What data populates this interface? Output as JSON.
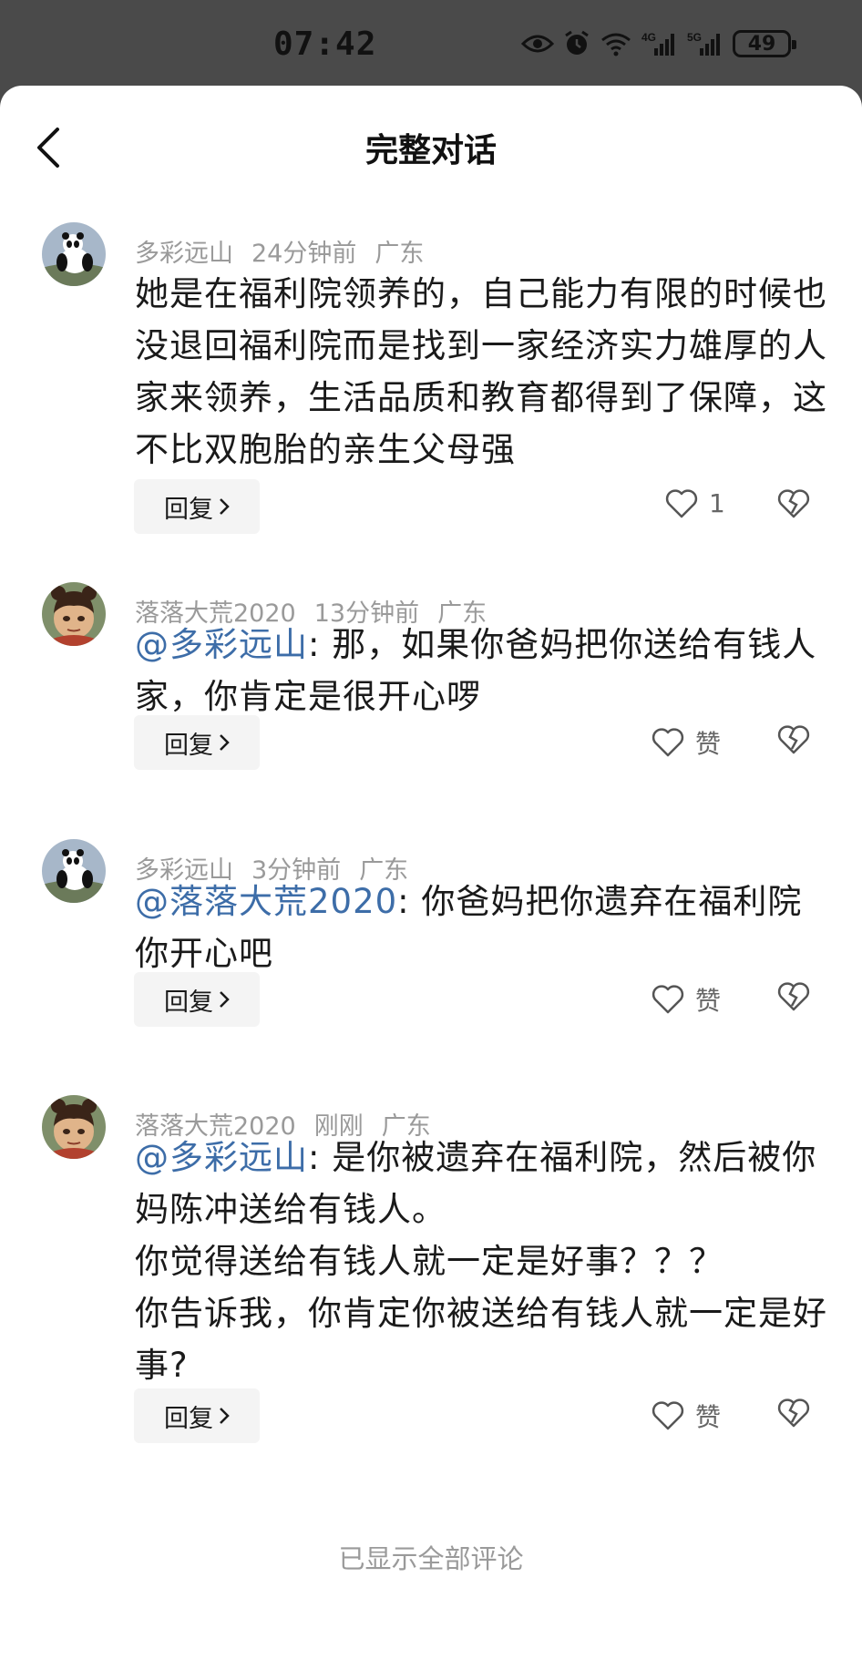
{
  "status": {
    "time": "07:42",
    "battery": "49"
  },
  "header": {
    "title": "完整对话"
  },
  "comments": [
    {
      "user": "多彩远山",
      "time": "24分钟前",
      "location": "广东",
      "mention": "",
      "text": "她是在福利院领养的，自己能力有限的时候也没退回福利院而是找到一家经济实力雄厚的人家来领养，生活品质和教育都得到了保障，这不比双胞胎的亲生父母强",
      "reply_label": "回复",
      "like_label": "1",
      "avatar": "panda-avatar"
    },
    {
      "user": "落落大荒2020",
      "time": "13分钟前",
      "location": "广东",
      "mention": "@多彩远山",
      "text": ": 那，如果你爸妈把你送给有钱人家，你肯定是很开心啰",
      "reply_label": "回复",
      "like_label": "赞",
      "avatar": "cartoon-girl-avatar"
    },
    {
      "user": "多彩远山",
      "time": "3分钟前",
      "location": "广东",
      "mention": "@落落大荒2020",
      "text": ": 你爸妈把你遗弃在福利院你开心吧",
      "reply_label": "回复",
      "like_label": "赞",
      "avatar": "panda-avatar"
    },
    {
      "user": "落落大荒2020",
      "time": "刚刚",
      "location": "广东",
      "mention": "@多彩远山",
      "text": ": 是你被遗弃在福利院，然后被你妈陈冲送给有钱人。\n你觉得送给有钱人就一定是好事？？？\n你告诉我，你肯定你被送给有钱人就一定是好事?",
      "reply_label": "回复",
      "like_label": "赞",
      "avatar": "cartoon-girl-avatar"
    }
  ],
  "footer": {
    "note": "已显示全部评论"
  },
  "colors": {
    "mention": "#3d6da8",
    "meta": "#9a9a9a",
    "status_bar": "#4a4a4a"
  }
}
